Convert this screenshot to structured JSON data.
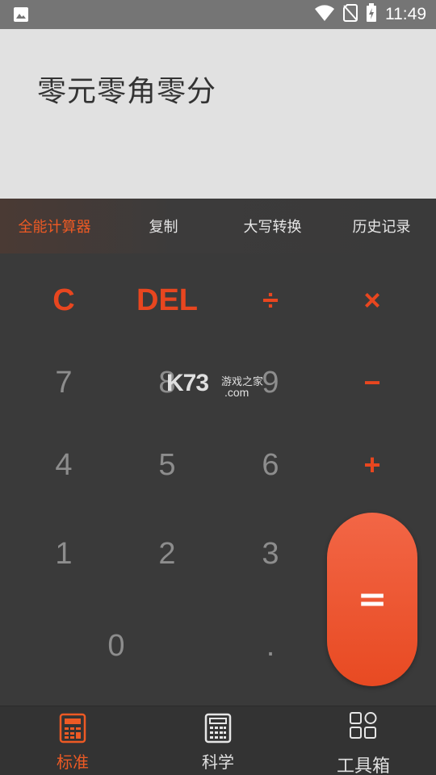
{
  "status_bar": {
    "time": "11:49",
    "icons": [
      "image-icon",
      "wifi-icon",
      "no-sim-icon",
      "battery-charging-icon"
    ]
  },
  "display": {
    "result_text": "零元零角零分"
  },
  "function_bar": {
    "items": [
      {
        "label": "全能计算器",
        "active": true
      },
      {
        "label": "复制",
        "active": false
      },
      {
        "label": "大写转换",
        "active": false
      },
      {
        "label": "历史记录",
        "active": false
      }
    ]
  },
  "keypad": {
    "clear": "C",
    "delete": "DEL",
    "divide": "÷",
    "multiply": "×",
    "minus": "−",
    "plus": "+",
    "equals": "=",
    "digits": {
      "seven": "7",
      "eight": "8",
      "nine": "9",
      "four": "4",
      "five": "5",
      "six": "6",
      "one": "1",
      "two": "2",
      "three": "3",
      "zero": "0",
      "dot": "."
    }
  },
  "watermark": {
    "brand": "K73",
    "cn": "游戏之家",
    "domain": ".com"
  },
  "bottom_nav": {
    "items": [
      {
        "label": "标准",
        "icon": "calculator-icon",
        "active": true
      },
      {
        "label": "科学",
        "icon": "scientific-calculator-icon",
        "active": false
      },
      {
        "label": "工具箱",
        "icon": "toolbox-grid-icon",
        "active": false
      }
    ]
  },
  "colors": {
    "accent": "#ee5a24",
    "keypad_bg": "#3a3a3a",
    "display_bg": "#e1e1e1",
    "digit": "#8d8d8d"
  }
}
